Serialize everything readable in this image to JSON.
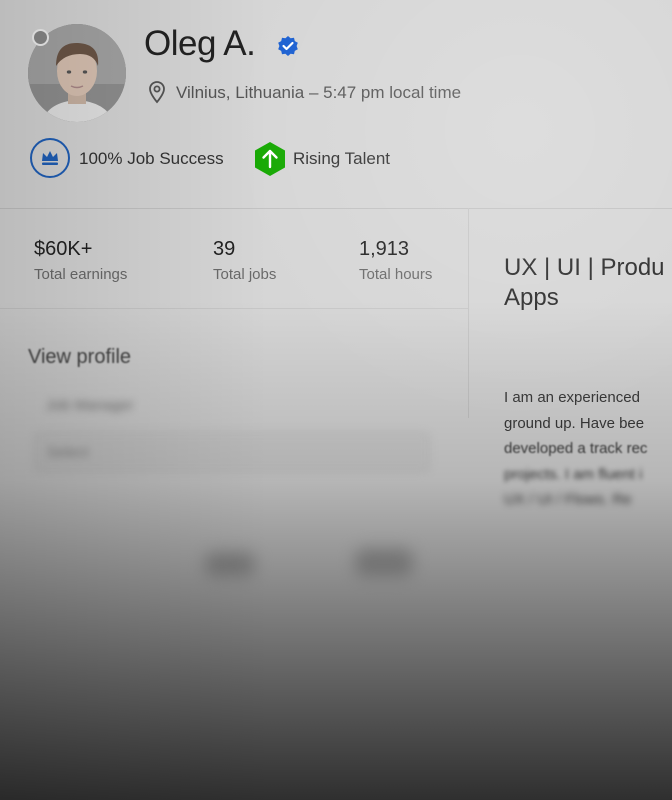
{
  "profile": {
    "name": "Oleg A.",
    "location": "Vilnius, Lithuania – 5:47 pm local time"
  },
  "badges": [
    {
      "label": "100% Job Success",
      "icon": "crown-icon",
      "color": "#1f5fb8"
    },
    {
      "label": "Rising Talent",
      "icon": "arrow-up-icon",
      "color": "#14a800"
    }
  ],
  "stats": [
    {
      "value": "$60K+",
      "label": "Total earnings"
    },
    {
      "value": "39",
      "label": "Total jobs"
    },
    {
      "value": "1,913",
      "label": "Total hours"
    }
  ],
  "headline": {
    "line1": "UX | UI | Produ",
    "line2": "Apps"
  },
  "description": {
    "lines": [
      "I am an experienced",
      "ground up. Have bee",
      "developed a track rec",
      "projects. I am fluent i",
      "UX / UI / Flows. Re"
    ]
  },
  "actions": {
    "view_profile": "View profile",
    "select_label": "Job Manager",
    "select_value": "Select"
  },
  "colors": {
    "verified": "#1a5fd1",
    "rising_talent": "#14a800",
    "job_success": "#1f5fb8"
  }
}
